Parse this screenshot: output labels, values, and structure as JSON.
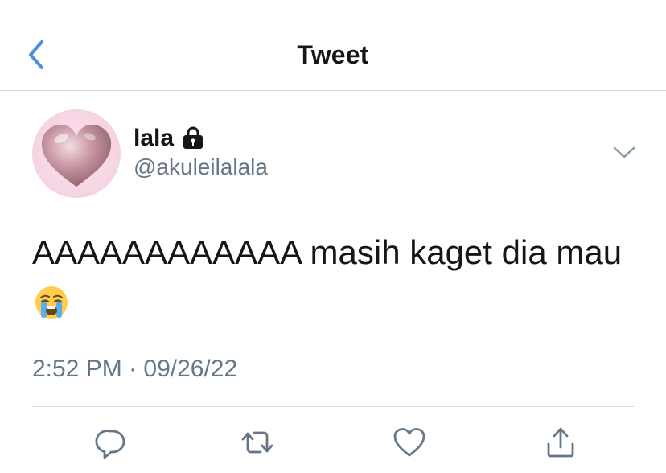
{
  "header": {
    "title": "Tweet",
    "back_icon": "chevron-left-icon",
    "accent_color": "#4a90e2"
  },
  "tweet": {
    "author": {
      "name": "lala",
      "handle": "@akuleilalala",
      "protected_icon": "lock-icon",
      "avatar": "pink-heart-avatar"
    },
    "text": "AAAAAAAAAAAA masih kaget dia mau",
    "emoji": "loudly-crying-face-emoji",
    "timestamp": "2:52 PM · 09/26/22",
    "menu_icon": "chevron-down-icon"
  },
  "actions": [
    {
      "icon": "reply-icon"
    },
    {
      "icon": "retweet-icon"
    },
    {
      "icon": "like-icon"
    },
    {
      "icon": "share-icon"
    }
  ],
  "colors": {
    "text_primary": "#14171a",
    "text_secondary": "#657786",
    "divider": "#d9d9d9",
    "icon": "#657786"
  }
}
